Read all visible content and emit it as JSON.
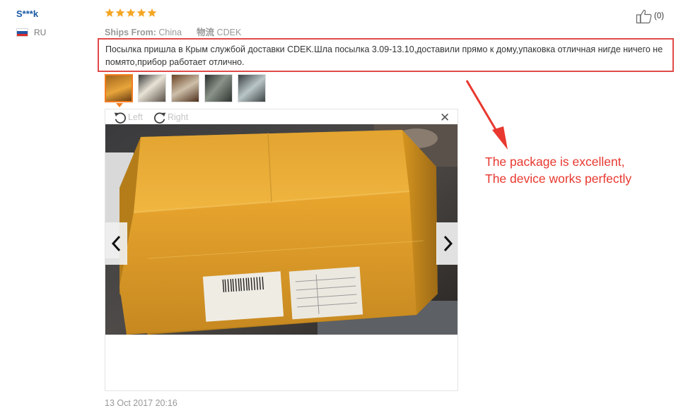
{
  "reviewer": {
    "name": "S***k",
    "country": "RU",
    "flag_colors": [
      "#ffffff",
      "#2156a8",
      "#d92b2b"
    ]
  },
  "rating": {
    "stars": 5,
    "max": 5,
    "color": "#f5a623"
  },
  "shipping": {
    "ships_from_label": "Ships From:",
    "ships_from_value": "China",
    "carrier_label": "物流",
    "carrier_value": "CDEK"
  },
  "helpful": {
    "icon": "thumbs-up-icon",
    "count": "(0)"
  },
  "review": {
    "text": "Посылка пришла в Крым службой доставки CDEK.Шла посылка 3.09-13.10,доставили прямо к дому,упаковка отличная нигде ничего не помято,прибор работает отлично.",
    "highlight_color": "#e04a4a"
  },
  "thumbnails": [
    {
      "name": "thumbnail-1",
      "active": true
    },
    {
      "name": "thumbnail-2",
      "active": false
    },
    {
      "name": "thumbnail-3",
      "active": false
    },
    {
      "name": "thumbnail-4",
      "active": false
    },
    {
      "name": "thumbnail-5",
      "active": false
    }
  ],
  "viewer": {
    "rotate_left_label": "Left",
    "rotate_right_label": "Right",
    "close_icon": "close-icon",
    "prev_icon": "chevron-left-icon",
    "next_icon": "chevron-right-icon"
  },
  "date": "13 Oct 2017 20:16",
  "annotation": {
    "line1": "The package is excellent,",
    "line2": "The device works perfectly",
    "color": "#e8382f"
  }
}
